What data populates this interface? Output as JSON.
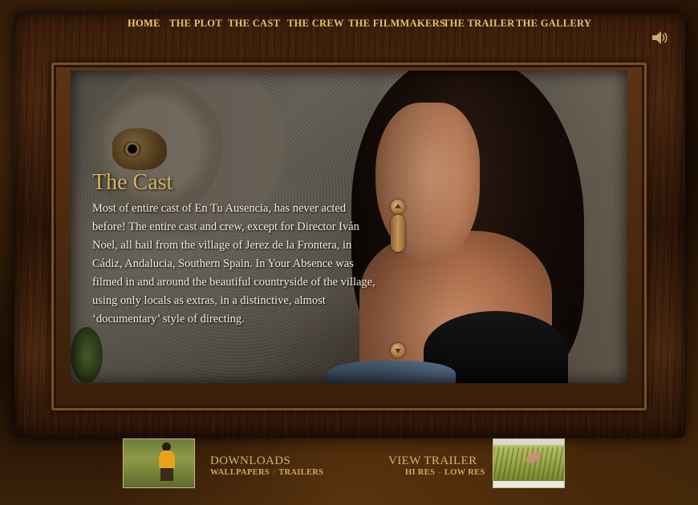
{
  "nav": {
    "items": [
      {
        "label": "HOME",
        "active": true
      },
      {
        "label": "THE PLOT",
        "active": false
      },
      {
        "label": "THE CAST",
        "active": false
      },
      {
        "label": "THE CREW",
        "active": false
      },
      {
        "label": "THE FILMMAKERS",
        "active": false
      },
      {
        "label": "THE TRAILER",
        "active": false
      },
      {
        "label": "THE GALLERY",
        "active": false
      }
    ],
    "speaker_icon": "speaker-icon"
  },
  "content": {
    "title": "The Cast",
    "body": "Most of entire cast of En Tu Ausencia, has never acted before!  The entire cast and crew, except for Director Iván Noel, all hail from the village of Jerez de la Frontera, in Cádiz, Andalucia, Southern Spain. In Your Absence was filmed in and around the beautiful countryside of the village, using only locals as extras, in a distinctive, almost ‘documentary’ style of directing."
  },
  "footer": {
    "downloads": {
      "title": "DOWNLOADS",
      "links": [
        "WALLPAPERS",
        "TRAILERS"
      ],
      "separator": "/"
    },
    "trailer": {
      "title": "VIEW TRAILER",
      "links": [
        "HI RES",
        "LOW RES"
      ],
      "separator": "-"
    }
  },
  "colors": {
    "nav_text": "#e3c36a",
    "title": "#d9b25c",
    "body_text": "#f4ece0",
    "frame_wood": "#3a1d0a"
  }
}
